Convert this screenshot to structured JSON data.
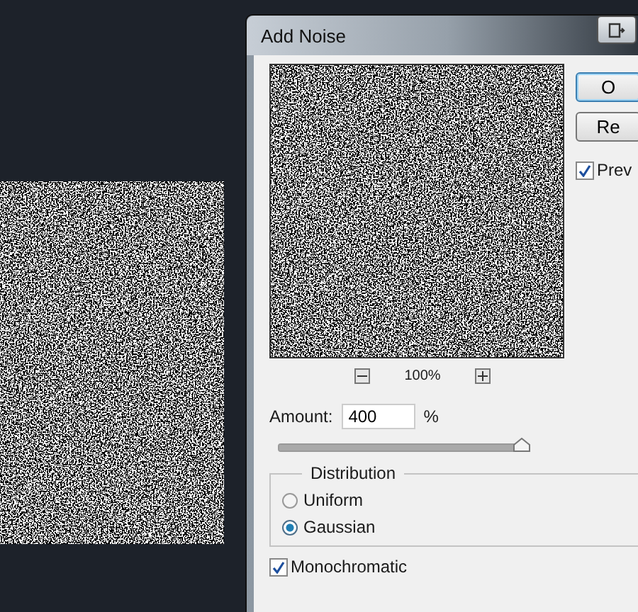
{
  "dialog": {
    "title": "Add Noise",
    "buttons": [
      {
        "label": "O",
        "default": true
      },
      {
        "label": "Re",
        "default": false
      }
    ],
    "preview_checkbox": {
      "label": "Prev",
      "checked": true
    },
    "zoom": {
      "value": "100%"
    },
    "amount": {
      "label": "Amount:",
      "value": "400",
      "unit": "%",
      "level": 0.97
    },
    "distribution": {
      "title": "Distribution",
      "options": [
        {
          "label": "Uniform",
          "selected": false
        },
        {
          "label": "Gaussian",
          "selected": true
        }
      ]
    },
    "monochromatic": {
      "label": "Monochromatic",
      "checked": true
    }
  }
}
